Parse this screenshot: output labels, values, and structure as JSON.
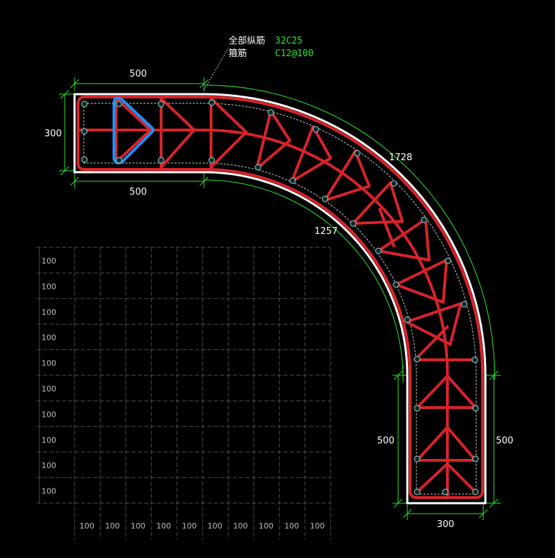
{
  "annotation": {
    "longitudinal_label": "全部纵筋",
    "longitudinal_value": "32C25",
    "stirrup_label": "箍筋",
    "stirrup_value": "C12@100"
  },
  "dimensions": {
    "top_width": "500",
    "left_height": "300",
    "bottom_width": "500",
    "outer_arc": "1728",
    "inner_arc": "1257",
    "right_inner_height": "500",
    "right_outer_height": "500",
    "bottom_depth": "300"
  },
  "grid": {
    "row_label": "100",
    "col_label": "100"
  },
  "colors": {
    "background": "#000000",
    "outline": "#ffffff",
    "rebar": "#d9232a",
    "highlight_stirrup": "#1e90ff",
    "dimension": "#2ee52e",
    "grid": "#5a5a66"
  }
}
